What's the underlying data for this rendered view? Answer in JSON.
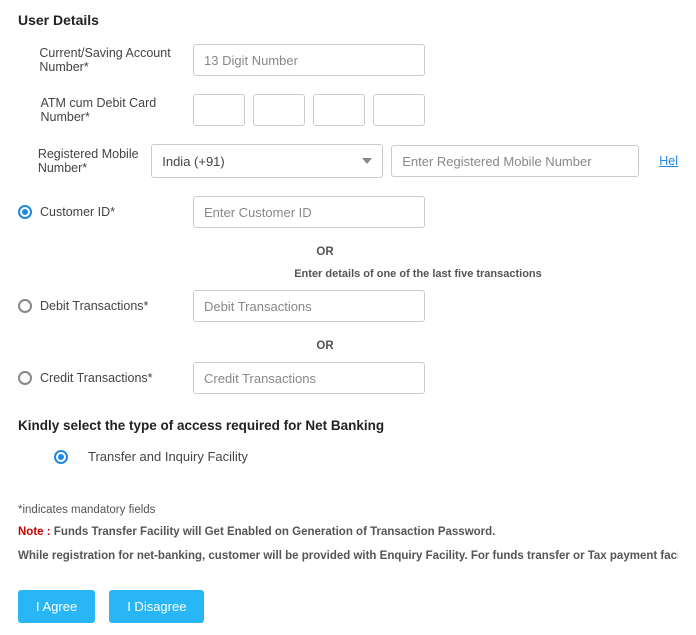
{
  "title": "User Details",
  "fields": {
    "account_label": "Current/Saving Account Number*",
    "account_placeholder": "13 Digit Number",
    "atm_label": "ATM cum Debit Card Number*",
    "mobile_label": "Registered Mobile Number*",
    "country_value": "India (+91)",
    "mobile_placeholder": "Enter Registered Mobile Number",
    "help_text": "Hel",
    "customer_label": "Customer ID*",
    "customer_placeholder": "Enter Customer ID",
    "or_text": "OR",
    "txn_instruction": "Enter details of one of the last five transactions",
    "debit_label": "Debit Transactions*",
    "debit_placeholder": "Debit Transactions",
    "credit_label": "Credit Transactions*",
    "credit_placeholder": "Credit Transactions"
  },
  "access": {
    "title": "Kindly select the type of access required for Net Banking",
    "option1": "Transfer and Inquiry Facility"
  },
  "notes": {
    "mandatory": "*indicates mandatory fields",
    "note_label": "Note :",
    "note_text": " Funds Transfer Facility will Get Enabled on Generation of Transaction Password.",
    "info": "While registration for net-banking, customer will be provided with Enquiry Facility. For funds transfer or Tax payment facility, customer has to get a tran"
  },
  "buttons": {
    "agree": "I Agree",
    "disagree": "I Disagree"
  }
}
